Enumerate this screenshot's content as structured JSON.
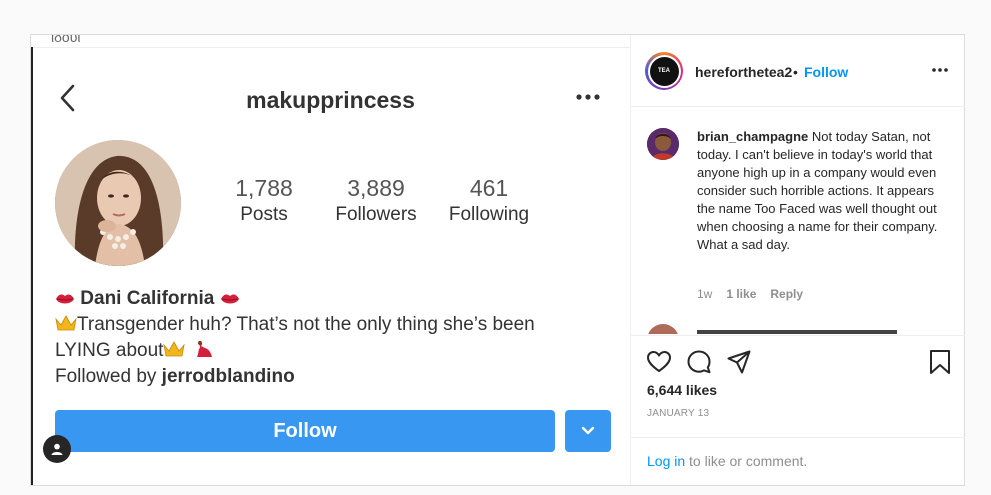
{
  "media": {
    "cut_text": "ιδουι",
    "username": "makupprincess",
    "stats": [
      {
        "num": "1,788",
        "label": "Posts"
      },
      {
        "num": "3,889",
        "label": "Followers"
      },
      {
        "num": "461",
        "label": "Following"
      }
    ],
    "bio_name": "Dani California",
    "bio_line2": "Transgender huh? That’s not the only thing she’s been",
    "bio_line3": "LYING about",
    "followed_by_prefix": "Followed by ",
    "followed_by_user": "jerrodblandino",
    "follow_button": "Follow"
  },
  "panel": {
    "username": "hereforthetea2",
    "dot": "•",
    "follow": "Follow",
    "avatar_text": "TEA"
  },
  "comment": {
    "user": "brian_champagne",
    "text": " Not today Satan, not today. I can't believe in today's world that anyone high up in a company would even consider such horrible actions. It appears the name Too Faced was well thought out when choosing a name for their company. What a sad day.",
    "time": "1w",
    "likes": "1 like",
    "reply": "Reply"
  },
  "likes": "6,644 likes",
  "date": "JANUARY 13",
  "login": {
    "link": "Log in",
    "rest": " to like or comment."
  },
  "colors": {
    "accent": "#3897f0",
    "link": "#0095f6"
  }
}
